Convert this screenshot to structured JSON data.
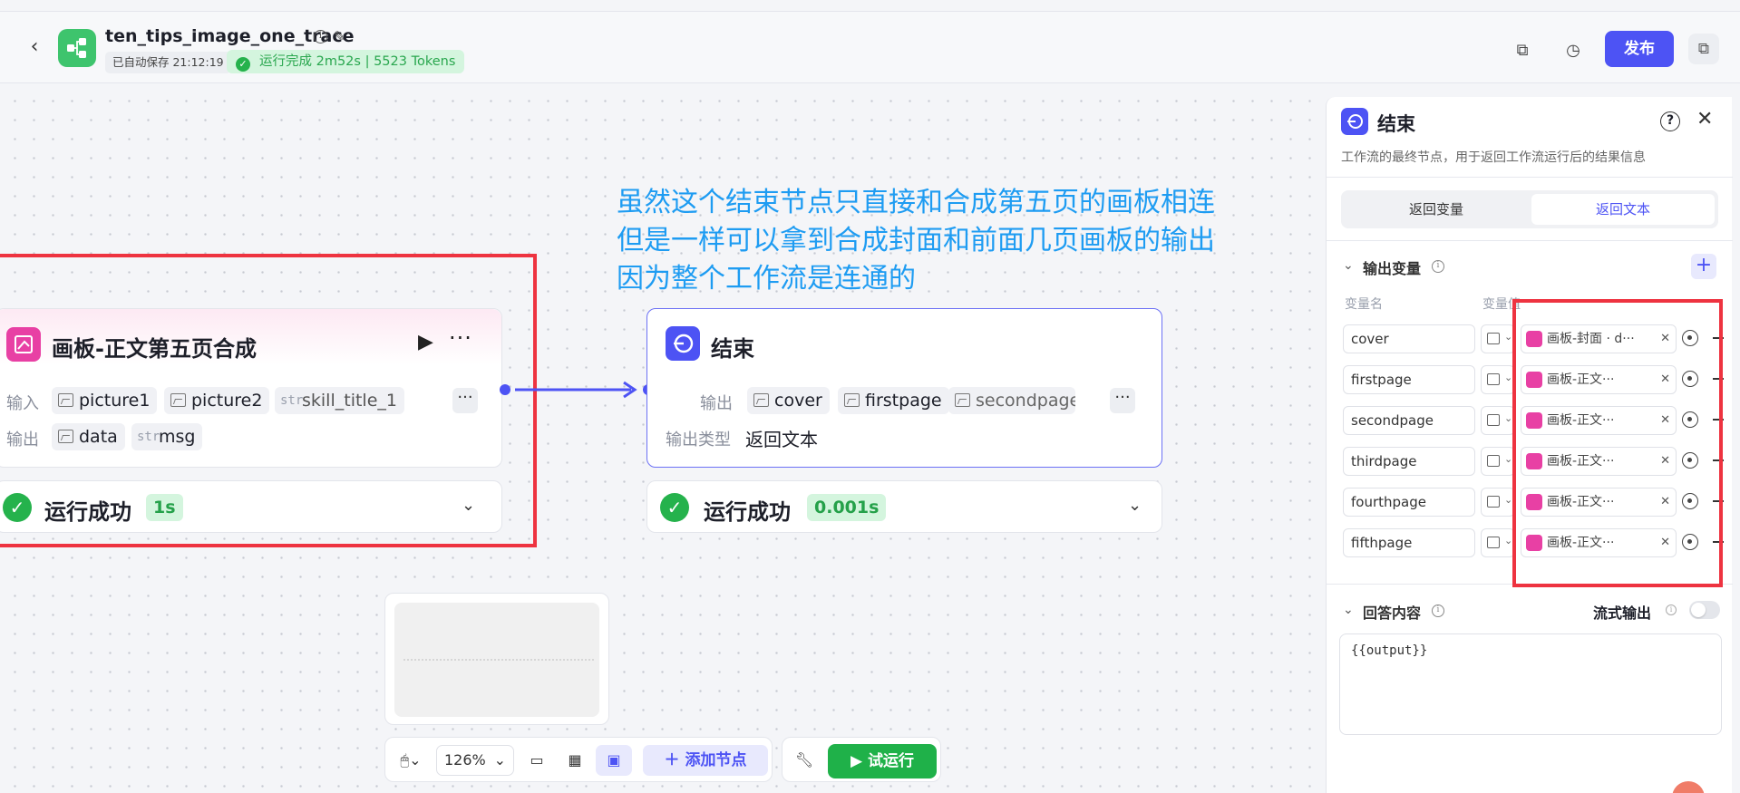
{
  "header": {
    "title": "ten_tips_image_one_trace",
    "autosave": "已自动保存 21:12:19",
    "run_status": "运行完成 2m52s | 5523 Tokens",
    "publish_label": "发布"
  },
  "annotation": {
    "text": "虽然这个结束节点只直接和合成第五页的画板相连\n但是一样可以拿到合成封面和前面几页画板的输出\n因为整个工作流是连通的"
  },
  "node_board": {
    "title": "画板-正文第五页合成",
    "input_label": "输入",
    "output_label": "输出",
    "inputs": [
      {
        "type": "image",
        "name": "picture1"
      },
      {
        "type": "image",
        "name": "picture2"
      },
      {
        "type": "str",
        "name": "skill_title_1"
      }
    ],
    "outputs": [
      {
        "type": "image",
        "name": "data"
      },
      {
        "type": "str",
        "name": "msg"
      }
    ],
    "status_text": "运行成功",
    "duration": "1s"
  },
  "node_end": {
    "title": "结束",
    "output_label": "输出",
    "outputs": [
      "cover",
      "firstpage",
      "secondpage"
    ],
    "output_type_label": "输出类型",
    "output_type_value": "返回文本",
    "status_text": "运行成功",
    "duration": "0.001s"
  },
  "toolbar": {
    "zoom": "126%",
    "add_node_label": "添加节点",
    "test_run_label": "试运行"
  },
  "panel": {
    "title": "结束",
    "description": "工作流的最终节点，用于返回工作流运行后的结果信息",
    "tabs": [
      "返回变量",
      "返回文本"
    ],
    "active_tab": "返回文本",
    "output_vars_title": "输出变量",
    "col_var_name": "变量名",
    "col_var_value": "变量值",
    "variables": [
      {
        "name": "cover",
        "ref": "画板-封面 · d···"
      },
      {
        "name": "firstpage",
        "ref": "画板-正文···"
      },
      {
        "name": "secondpage",
        "ref": "画板-正文···"
      },
      {
        "name": "thirdpage",
        "ref": "画板-正文···"
      },
      {
        "name": "fourthpage",
        "ref": "画板-正文···"
      },
      {
        "name": "fifthpage",
        "ref": "画板-正文···"
      }
    ],
    "answer_title": "回答内容",
    "stream_label": "流式输出",
    "answer_content": "{{output}}"
  },
  "colors": {
    "accent": "#4d53f4",
    "success": "#25b24c",
    "annotation": "#1e9cf2",
    "highlight_box": "#ee3340",
    "board_icon": "#e840a4"
  }
}
